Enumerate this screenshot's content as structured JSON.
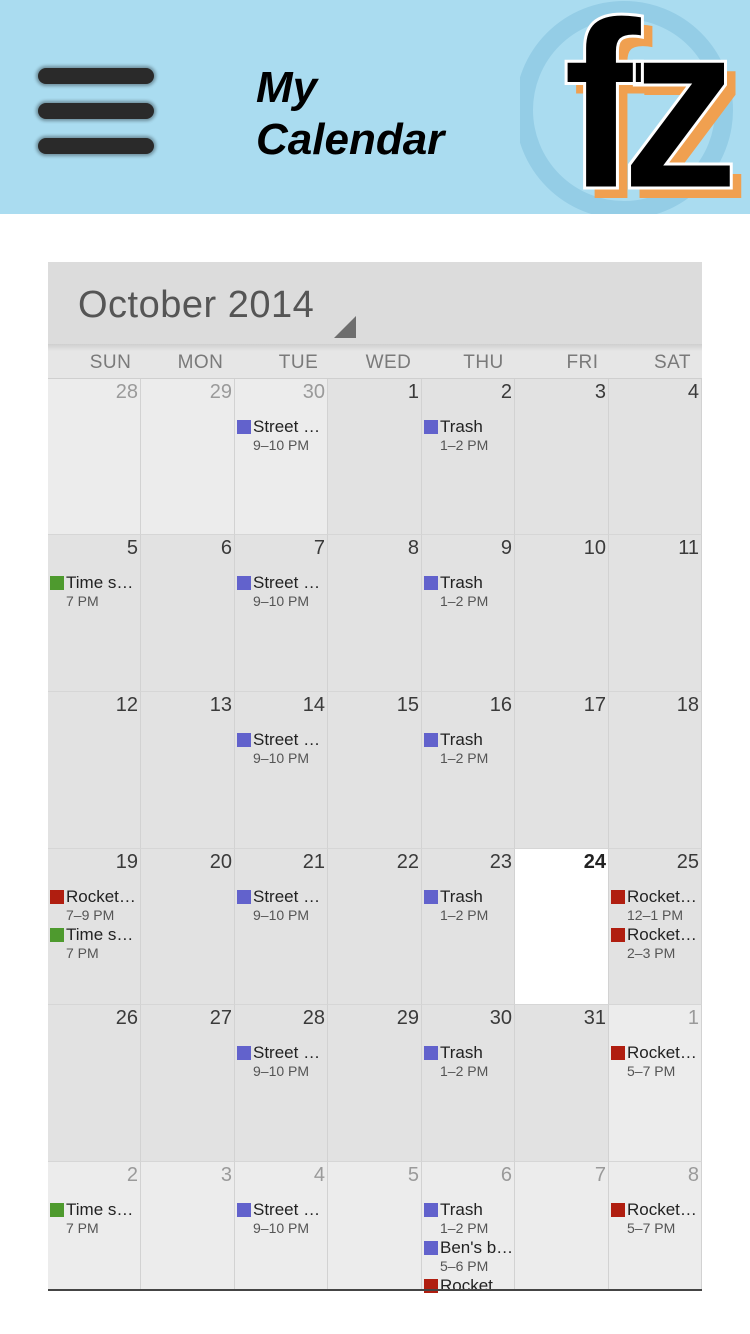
{
  "header": {
    "title_line1": "My",
    "title_line2": "Calendar",
    "logo_text": "fz",
    "bg_color": "#aadcf0"
  },
  "calendar": {
    "month_label": "October 2014",
    "weekdays": [
      "SUN",
      "MON",
      "TUE",
      "WED",
      "THU",
      "FRI",
      "SAT"
    ],
    "colors": {
      "blue": "#6262cc",
      "green": "#4e9a2e",
      "red": "#b01e10"
    },
    "weeks": [
      [
        {
          "day": "28",
          "other": true,
          "events": []
        },
        {
          "day": "29",
          "other": true,
          "events": []
        },
        {
          "day": "30",
          "other": true,
          "events": [
            {
              "title": "Street sweeping",
              "time": "9–10 PM",
              "color": "blue"
            }
          ]
        },
        {
          "day": "1",
          "events": []
        },
        {
          "day": "2",
          "events": [
            {
              "title": "Trash",
              "time": "1–2 PM",
              "color": "blue"
            }
          ]
        },
        {
          "day": "3",
          "events": []
        },
        {
          "day": "4",
          "events": []
        }
      ],
      [
        {
          "day": "5",
          "events": [
            {
              "title": "Time sheet",
              "time": "7 PM",
              "color": "green"
            }
          ]
        },
        {
          "day": "6",
          "events": []
        },
        {
          "day": "7",
          "events": [
            {
              "title": "Street sweeping",
              "time": "9–10 PM",
              "color": "blue"
            }
          ]
        },
        {
          "day": "8",
          "events": []
        },
        {
          "day": "9",
          "events": [
            {
              "title": "Trash",
              "time": "1–2 PM",
              "color": "blue"
            }
          ]
        },
        {
          "day": "10",
          "events": []
        },
        {
          "day": "11",
          "events": []
        }
      ],
      [
        {
          "day": "12",
          "events": []
        },
        {
          "day": "13",
          "events": []
        },
        {
          "day": "14",
          "events": [
            {
              "title": "Street sweeping",
              "time": "9–10 PM",
              "color": "blue"
            }
          ]
        },
        {
          "day": "15",
          "events": []
        },
        {
          "day": "16",
          "events": [
            {
              "title": "Trash",
              "time": "1–2 PM",
              "color": "blue"
            }
          ]
        },
        {
          "day": "17",
          "events": []
        },
        {
          "day": "18",
          "events": []
        }
      ],
      [
        {
          "day": "19",
          "events": [
            {
              "title": "Rockets game",
              "time": "7–9 PM",
              "color": "red"
            },
            {
              "title": "Time sheet",
              "time": "7 PM",
              "color": "green"
            }
          ]
        },
        {
          "day": "20",
          "events": []
        },
        {
          "day": "21",
          "events": [
            {
              "title": "Street sweeping",
              "time": "9–10 PM",
              "color": "blue"
            }
          ]
        },
        {
          "day": "22",
          "events": []
        },
        {
          "day": "23",
          "events": [
            {
              "title": "Trash",
              "time": "1–2 PM",
              "color": "blue"
            }
          ]
        },
        {
          "day": "24",
          "today": true,
          "events": []
        },
        {
          "day": "25",
          "events": [
            {
              "title": "Rockets game",
              "time": "12–1 PM",
              "color": "red"
            },
            {
              "title": "Rockets game",
              "time": "2–3 PM",
              "color": "red"
            }
          ]
        }
      ],
      [
        {
          "day": "26",
          "events": []
        },
        {
          "day": "27",
          "events": []
        },
        {
          "day": "28",
          "events": [
            {
              "title": "Street sweeping",
              "time": "9–10 PM",
              "color": "blue"
            }
          ]
        },
        {
          "day": "29",
          "events": []
        },
        {
          "day": "30",
          "events": [
            {
              "title": "Trash",
              "time": "1–2 PM",
              "color": "blue"
            }
          ]
        },
        {
          "day": "31",
          "events": []
        },
        {
          "day": "1",
          "other": true,
          "events": [
            {
              "title": "Rockets game",
              "time": "5–7 PM",
              "color": "red"
            }
          ]
        }
      ],
      [
        {
          "day": "2",
          "other": true,
          "events": [
            {
              "title": "Time sheet",
              "time": "7 PM",
              "color": "green"
            }
          ]
        },
        {
          "day": "3",
          "other": true,
          "events": []
        },
        {
          "day": "4",
          "other": true,
          "events": [
            {
              "title": "Street sweeping",
              "time": "9–10 PM",
              "color": "blue"
            }
          ]
        },
        {
          "day": "5",
          "other": true,
          "events": []
        },
        {
          "day": "6",
          "other": true,
          "events": [
            {
              "title": "Trash",
              "time": "1–2 PM",
              "color": "blue"
            },
            {
              "title": "Ben's birthday",
              "time": "5–6 PM",
              "color": "blue"
            },
            {
              "title": "Rockets game",
              "time": "",
              "color": "red"
            }
          ]
        },
        {
          "day": "7",
          "other": true,
          "events": []
        },
        {
          "day": "8",
          "other": true,
          "events": [
            {
              "title": "Rockets game",
              "time": "5–7 PM",
              "color": "red"
            }
          ]
        }
      ]
    ]
  }
}
